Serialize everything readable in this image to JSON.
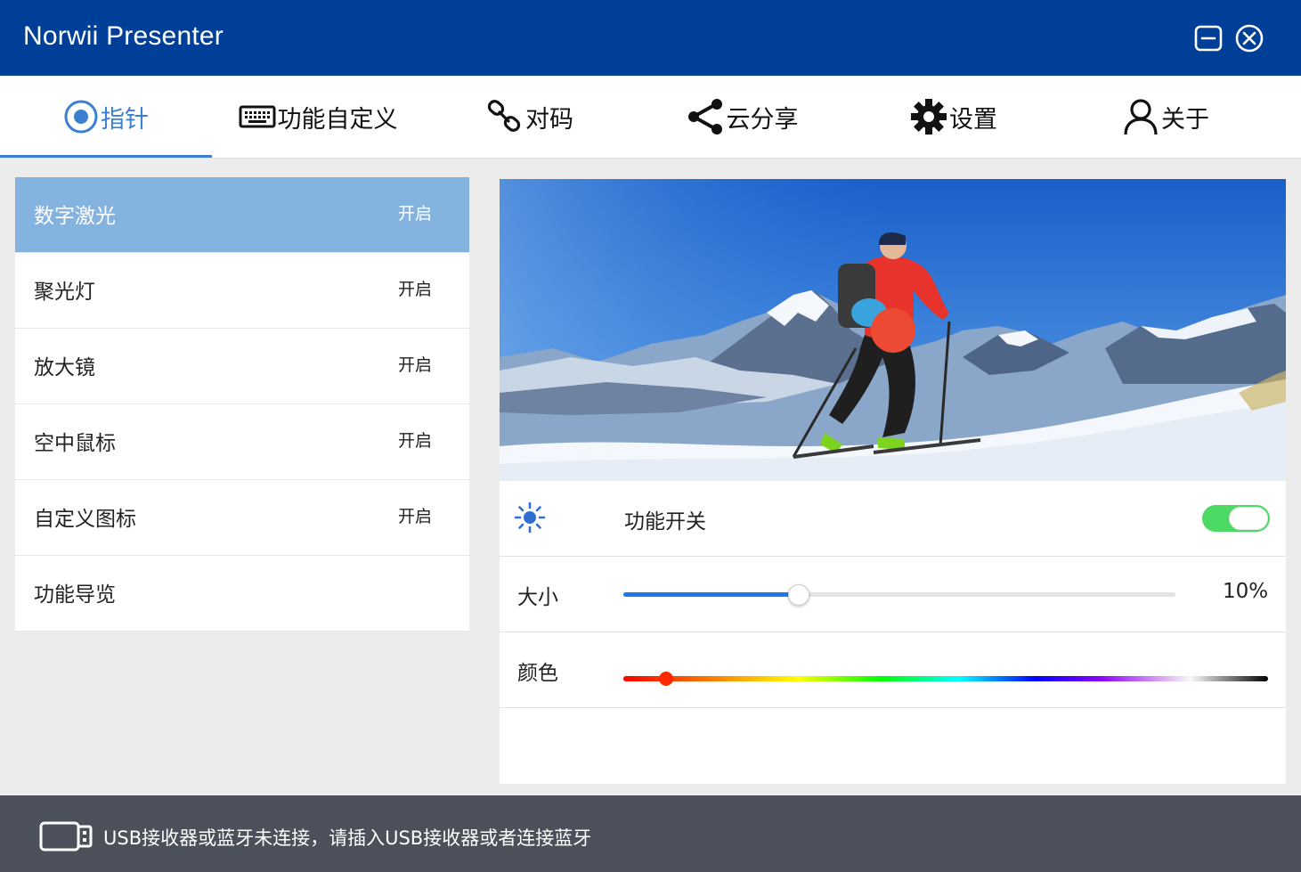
{
  "window": {
    "title": "Norwii Presenter",
    "minimize_icon": "minimize-icon",
    "close_icon": "close-circle-icon"
  },
  "tabs": [
    {
      "label": "指针",
      "icon": "pointer-target-icon",
      "active": true
    },
    {
      "label": "功能自定义",
      "icon": "keyboard-icon",
      "active": false
    },
    {
      "label": "对码",
      "icon": "link-icon",
      "active": false
    },
    {
      "label": "云分享",
      "icon": "share-icon",
      "active": false
    },
    {
      "label": "设置",
      "icon": "gear-icon",
      "active": false
    },
    {
      "label": "关于",
      "icon": "user-icon",
      "active": false
    }
  ],
  "sidebar": {
    "items": [
      {
        "label": "数字激光",
        "status": "开启",
        "active": true
      },
      {
        "label": "聚光灯",
        "status": "开启",
        "active": false
      },
      {
        "label": "放大镜",
        "status": "开启",
        "active": false
      },
      {
        "label": "空中鼠标",
        "status": "开启",
        "active": false
      },
      {
        "label": "自定义图标",
        "status": "开启",
        "active": false
      },
      {
        "label": "功能导览",
        "status": "",
        "active": false
      }
    ]
  },
  "preview": {
    "pointer_color": "#ec4a32"
  },
  "settings": {
    "feature_toggle": {
      "icon": "sun-icon",
      "label": "功能开关",
      "on": true
    },
    "size": {
      "label": "大小",
      "value_text": "10%",
      "fraction": 0.316
    },
    "color": {
      "label": "颜色",
      "selected": "#ff2a00",
      "fraction": 0.066
    }
  },
  "statusbar": {
    "icon": "usb-receiver-icon",
    "message": "USB接收器或蓝牙未连接，请插入USB接收器或者连接蓝牙"
  },
  "colors": {
    "titlebar": "#003f98",
    "accent": "#3a7fd0",
    "sidebar_active": "#85b3e0",
    "toggle_on": "#4cd964",
    "slider_fill": "#1f7ae8",
    "statusbar": "#4b505a"
  }
}
